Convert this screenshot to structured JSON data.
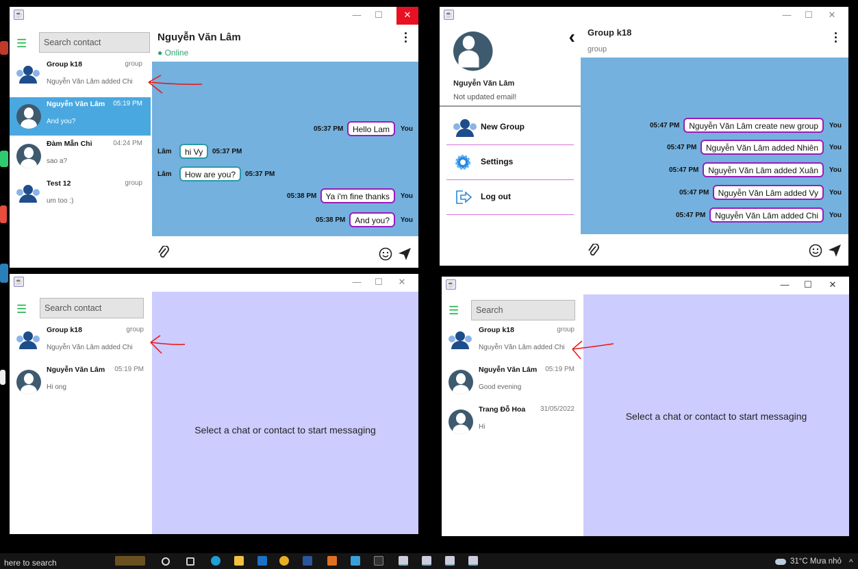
{
  "desktop": {
    "colors": {
      "accent_send": "#9a1bbb",
      "received_border": "#2a9aa8",
      "chat_bg": "#74b1de",
      "empty_bg": "#ccccff",
      "online": "#2ba26a"
    }
  },
  "win1": {
    "search_placeholder": "Search contact",
    "chat_name": "Nguyễn Văn Lâm",
    "chat_status": "Online",
    "contacts": [
      {
        "name": "Group k18",
        "time": "group",
        "preview": "Nguyễn Văn Lâm added Chi",
        "icon": "group-icon"
      },
      {
        "name": "Nguyễn Văn Lâm",
        "time": "05:19 PM",
        "preview": "And you?",
        "icon": "avatar-icon",
        "selected": true
      },
      {
        "name": "Đàm Mẫn Chi",
        "time": "04:24 PM",
        "preview": "sao a?",
        "icon": "avatar-icon"
      },
      {
        "name": "Test 12",
        "time": "group",
        "preview": "um too :)",
        "icon": "group-icon"
      }
    ],
    "messages": [
      {
        "dir": "out",
        "time": "05:37 PM",
        "text": "Hello Lam",
        "sender": "You"
      },
      {
        "dir": "in",
        "time": "05:37 PM",
        "text": "hi Vy",
        "sender": "Lâm"
      },
      {
        "dir": "in",
        "time": "05:37 PM",
        "text": "How are you?",
        "sender": "Lâm"
      },
      {
        "dir": "out",
        "time": "05:38 PM",
        "text": "Ya i'm fine thanks",
        "sender": "You"
      },
      {
        "dir": "out",
        "time": "05:38 PM",
        "text": "And you?",
        "sender": "You"
      }
    ]
  },
  "win2": {
    "profile_name": "Nguyễn Văn Lâm",
    "profile_email": "Not updated email!",
    "menu": [
      {
        "label": "New Group",
        "icon": "group-icon"
      },
      {
        "label": "Settings",
        "icon": "gear-icon"
      },
      {
        "label": "Log out",
        "icon": "logout-icon"
      }
    ],
    "chat_name": "Group k18",
    "chat_status": "group",
    "messages": [
      {
        "time": "05:47 PM",
        "text": "Nguyễn Văn Lâm create new group",
        "sender": "You"
      },
      {
        "time": "05:47 PM",
        "text": "Nguyễn Văn Lâm added Nhiên",
        "sender": "You"
      },
      {
        "time": "05:47 PM",
        "text": "Nguyễn Văn Lâm added Xuân",
        "sender": "You"
      },
      {
        "time": "05:47 PM",
        "text": "Nguyễn Văn Lâm added Vy",
        "sender": "You"
      },
      {
        "time": "05:47 PM",
        "text": "Nguyễn Văn Lâm added Chi",
        "sender": "You"
      }
    ]
  },
  "win3": {
    "search_placeholder": "Search contact",
    "contacts": [
      {
        "name": "Group k18",
        "time": "group",
        "preview": "Nguyễn Văn Lâm added Chi",
        "icon": "group-icon"
      },
      {
        "name": "Nguyễn Văn Lâm",
        "time": "05:19 PM",
        "preview": "Hi ong",
        "icon": "avatar-icon"
      }
    ],
    "empty_text": "Select a chat or contact to start messaging"
  },
  "win4": {
    "search_placeholder": "Search",
    "contacts": [
      {
        "name": "Group k18",
        "time": "group",
        "preview": "Nguyễn Văn Lâm added Chi",
        "icon": "group-icon"
      },
      {
        "name": "Nguyễn Văn Lâm",
        "time": "05:19 PM",
        "preview": "Good evening",
        "icon": "avatar-icon"
      },
      {
        "name": "Trang Đỗ Hoa",
        "time": "31/05/2022",
        "preview": "Hi",
        "icon": "avatar-icon"
      }
    ],
    "empty_text": "Select a chat or contact to start messaging"
  },
  "taskbar": {
    "search_text": "here to search",
    "weather": "31°C Mưa nhỏ",
    "chevron": "^"
  }
}
